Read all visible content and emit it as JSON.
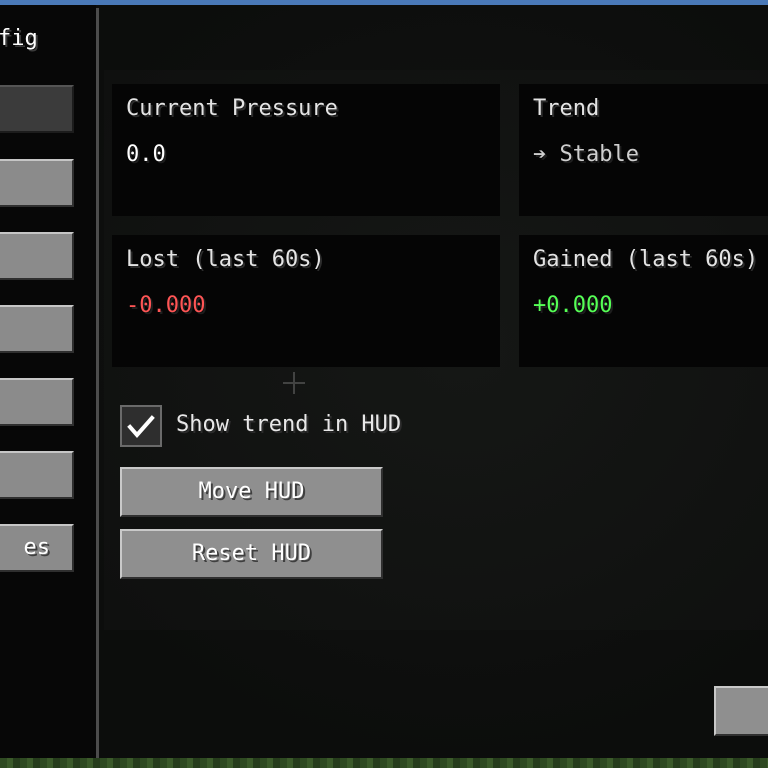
{
  "sidebar": {
    "title": "fig",
    "items": [
      {
        "label": ""
      },
      {
        "label": ""
      },
      {
        "label": ""
      },
      {
        "label": ""
      },
      {
        "label": ""
      },
      {
        "label": ""
      },
      {
        "label": "es"
      }
    ]
  },
  "stats": {
    "current_pressure": {
      "label": "Current Pressure",
      "value": "0.0"
    },
    "trend": {
      "label": "Trend",
      "value": "➔ Stable"
    },
    "lost": {
      "label": "Lost (last 60s)",
      "value": "-0.000"
    },
    "gained": {
      "label": "Gained (last 60s)",
      "value": "+0.000"
    }
  },
  "options": {
    "show_trend_label": "Show trend in HUD",
    "show_trend_checked": true,
    "move_hud_label": "Move HUD",
    "reset_hud_label": "Reset HUD"
  },
  "colors": {
    "lost": "#ff5555",
    "gained": "#55ff55",
    "trend": "#cfcfcf",
    "pressure": "#ffffff"
  }
}
